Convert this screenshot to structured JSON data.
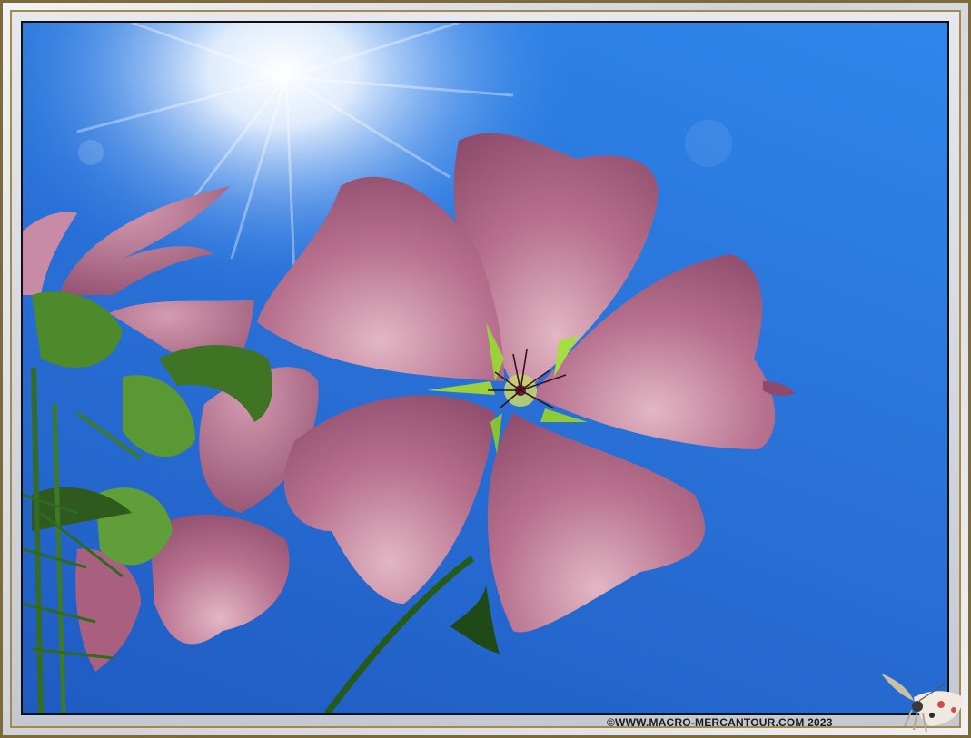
{
  "photo": {
    "subject": "pink mallow flower backlit against blue sky with sun rays",
    "sky_color": "#2a73d9",
    "petal_color": "#b9708f",
    "leaf_color": "#4f8a2a"
  },
  "watermark": {
    "text": "©WWW.MACRO-MERCANTOUR.COM 2023"
  },
  "logo": {
    "icon": "insect-logo-icon"
  }
}
